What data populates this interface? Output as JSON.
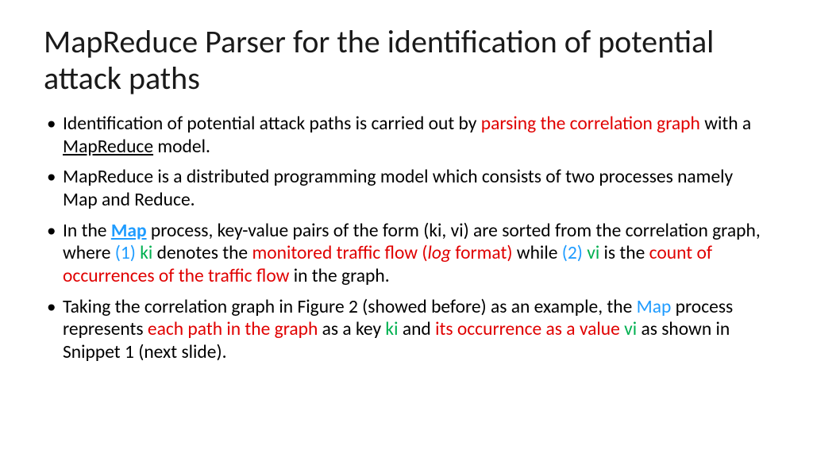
{
  "title": "MapReduce Parser for the identification of potential attack paths",
  "bullets": {
    "b1": {
      "s1": "Identification of potential attack paths is carried out by ",
      "s2": "parsing the correlation graph",
      "s3": " with a ",
      "s4": "MapReduce",
      "s5": " model."
    },
    "b2": {
      "s1": "MapReduce is a distributed programming model which consists of two processes namely Map and Reduce."
    },
    "b3": {
      "s1": "In the ",
      "s2": "Map",
      "s3": " process, key-value pairs of the form (ki, vi) are sorted from the correlation graph, where ",
      "s4": "(1) ",
      "s5": "ki",
      "s6": " denotes the ",
      "s7": "monitored traffic flow (",
      "s8": "log",
      "s9": " format)",
      "s10": " while ",
      "s11": "(2) ",
      "s12": "vi",
      "s13": " is the ",
      "s14": "count of occurrences of the traffic flow",
      "s15": " in the graph."
    },
    "b4": {
      "s1": "Taking the correlation graph in Figure 2 (showed before) as an example, the ",
      "s2": "Map",
      "s3": " process represents ",
      "s4": "each path in the graph",
      "s5": " as a key ",
      "s6": "ki",
      "s7": " and ",
      "s8": "its occurrence as a value ",
      "s9": "vi",
      "s10": " as shown in Snippet 1 (next slide)."
    }
  }
}
